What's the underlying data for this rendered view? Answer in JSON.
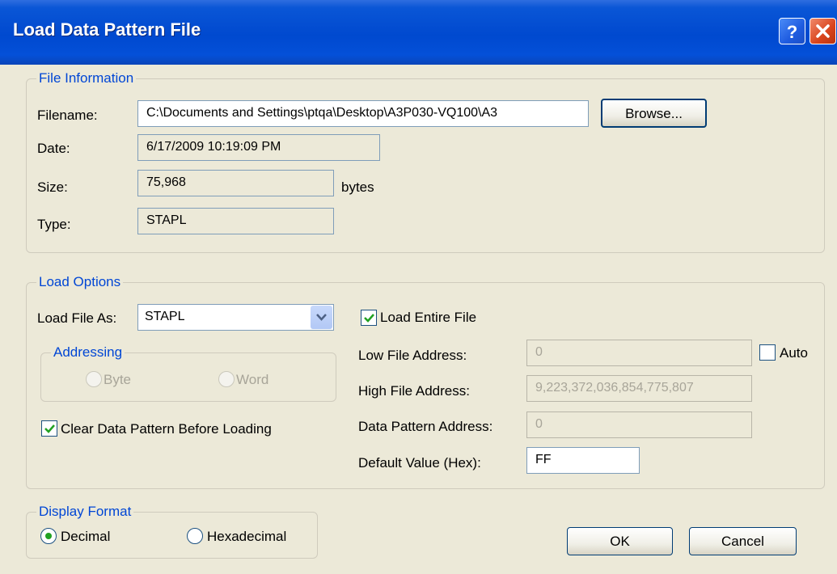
{
  "window": {
    "title": "Load Data Pattern File",
    "help_label": "?",
    "close_label": "X"
  },
  "file_info": {
    "legend": "File Information",
    "filename_label": "Filename:",
    "filename_value": "C:\\Documents and Settings\\ptqa\\Desktop\\A3P030-VQ100\\A3",
    "browse_label": "Browse...",
    "date_label": "Date:",
    "date_value": "6/17/2009 10:19:09 PM",
    "size_label": "Size:",
    "size_value": "75,968",
    "size_unit": "bytes",
    "type_label": "Type:",
    "type_value": "STAPL"
  },
  "load_options": {
    "legend": "Load Options",
    "load_as_label": "Load File As:",
    "load_as_value": "STAPL",
    "load_entire_label": "Load Entire File",
    "load_entire_checked": true,
    "addressing_legend": "Addressing",
    "byte_label": "Byte",
    "word_label": "Word",
    "clear_label": "Clear Data Pattern Before Loading",
    "clear_checked": true,
    "low_label": "Low File Address:",
    "low_value": "0",
    "auto_label": "Auto",
    "auto_checked": false,
    "high_label": "High File Address:",
    "high_value": "9,223,372,036,854,775,807",
    "dp_label": "Data Pattern Address:",
    "dp_value": "0",
    "default_label": "Default Value (Hex):",
    "default_value": "FF"
  },
  "display_format": {
    "legend": "Display Format",
    "decimal_label": "Decimal",
    "hex_label": "Hexadecimal",
    "selected": "Decimal"
  },
  "actions": {
    "ok_label": "OK",
    "cancel_label": "Cancel"
  }
}
